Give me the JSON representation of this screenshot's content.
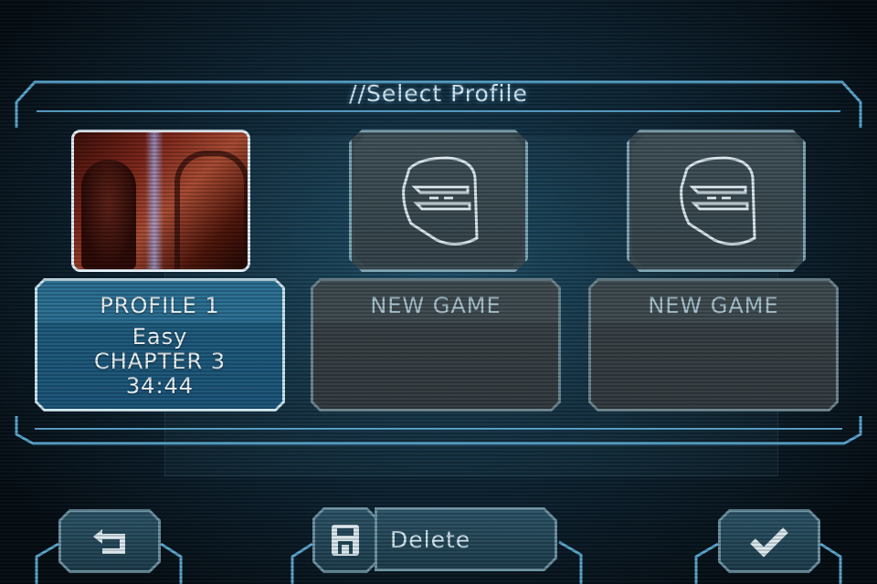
{
  "screen": {
    "title": "//Select Profile"
  },
  "profiles": [
    {
      "header": "PROFILE 1",
      "difficulty": "Easy",
      "chapter": "CHAPTER 3",
      "time": "34:44",
      "thumbnail": "gameplay-screenshot"
    },
    {
      "header": "NEW GAME",
      "thumbnail": "helmet-icon"
    },
    {
      "header": "NEW GAME",
      "thumbnail": "helmet-icon"
    }
  ],
  "toolbar": {
    "back_icon": "return-arrow-icon",
    "save_icon": "floppy-disk-icon",
    "delete_label": "Delete",
    "confirm_icon": "checkmark-icon"
  },
  "colors": {
    "accent": "#6fc2ea",
    "active_slot": "#1f6088",
    "empty_slot": "#3a454b",
    "frame": "#5aa7cf"
  }
}
